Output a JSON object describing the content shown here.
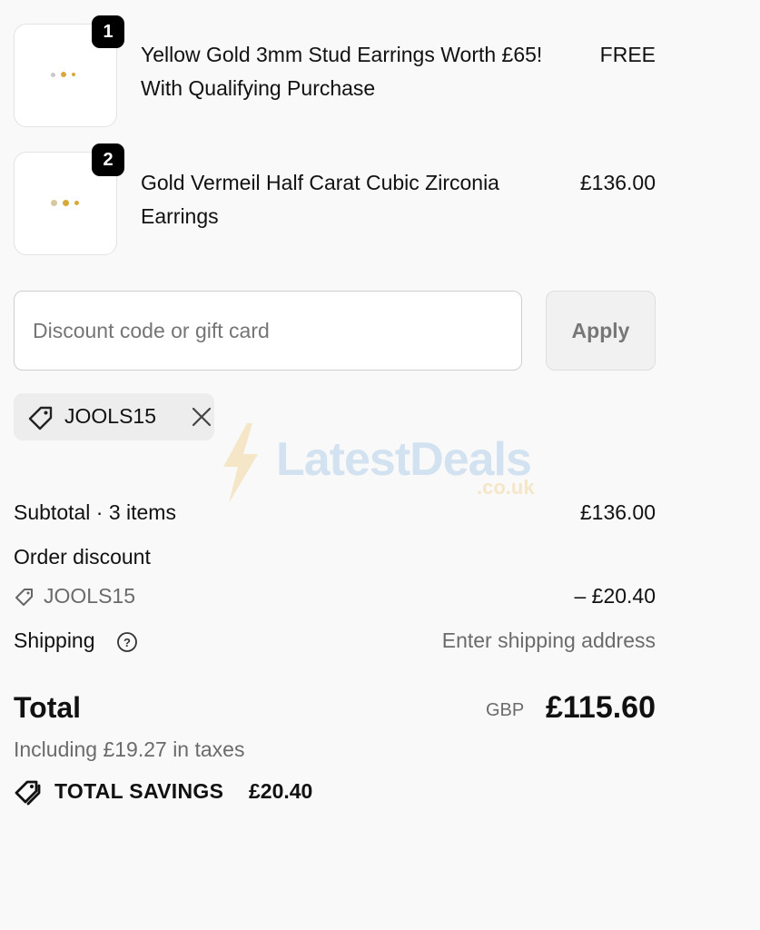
{
  "items": [
    {
      "qty": "1",
      "name": "Yellow Gold 3mm Stud Earrings Worth £65! With Qualifying Purchase",
      "price": "FREE"
    },
    {
      "qty": "2",
      "name": "Gold Vermeil Half Carat Cubic Zirconia Earrings",
      "price": "£136.00"
    }
  ],
  "discount": {
    "placeholder": "Discount code or gift card",
    "apply_label": "Apply",
    "applied_code": "JOOLS15"
  },
  "watermark": {
    "name": "LatestDeals",
    "domain": ".co.uk"
  },
  "summary": {
    "subtotal_label": "Subtotal · 3 items",
    "subtotal_value": "£136.00",
    "order_discount_label": "Order discount",
    "discount_code": "JOOLS15",
    "discount_value": "– £20.40",
    "shipping_label": "Shipping",
    "shipping_value": "Enter shipping address",
    "total_label": "Total",
    "currency": "GBP",
    "total_value": "£115.60",
    "taxes_note": "Including £19.27 in taxes",
    "savings_label": "TOTAL SAVINGS",
    "savings_value": "£20.40"
  },
  "icons": {
    "tag": "tag-icon",
    "close": "close-icon",
    "help": "help-circle-icon",
    "savings": "double-tag-icon",
    "bolt": "lightning-bolt-icon"
  },
  "colors": {
    "background": "#f9f9f9",
    "badge": "#000000",
    "chip": "#ededed",
    "muted_text": "#6b6b6b",
    "watermark_blue": "#6fa9dc",
    "watermark_gold": "#e8b84a"
  }
}
